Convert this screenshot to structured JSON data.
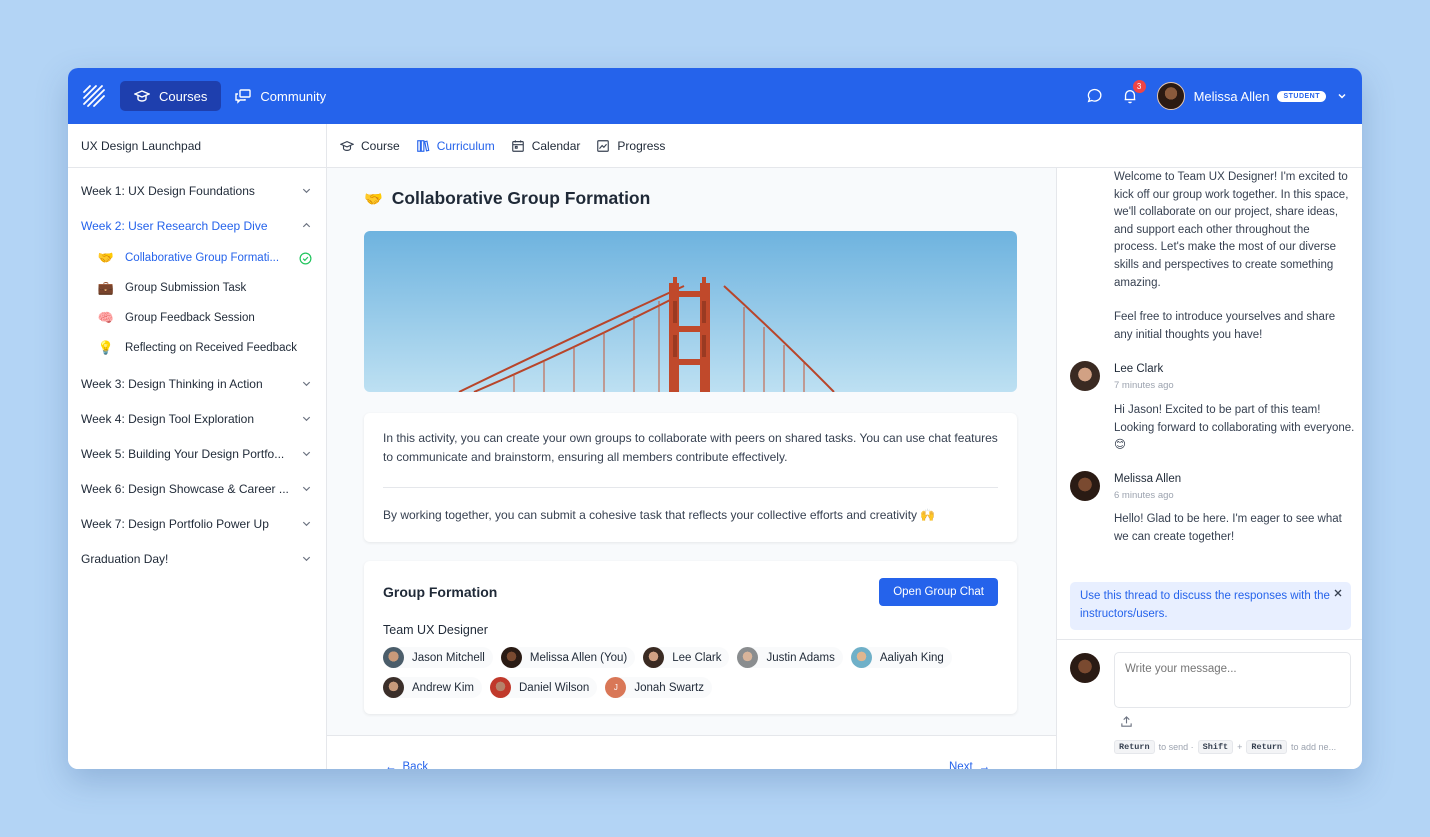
{
  "topbar": {
    "nav": [
      {
        "label": "Courses",
        "icon": "graduation-cap-icon",
        "active": true
      },
      {
        "label": "Community",
        "icon": "chat-bubbles-icon",
        "active": false
      }
    ],
    "notifications_count": "3",
    "user_name": "Melissa Allen",
    "user_role": "STUDENT"
  },
  "sidebar": {
    "course_title": "UX Design Launchpad",
    "weeks": [
      {
        "label": "Week 1: UX Design Foundations"
      },
      {
        "label": "Week 2: User Research Deep Dive"
      },
      {
        "label": "Week 3: Design Thinking in Action"
      },
      {
        "label": "Week 4: Design Tool Exploration"
      },
      {
        "label": "Week 5: Building Your Design Portfo..."
      },
      {
        "label": "Week 6: Design Showcase & Career ..."
      },
      {
        "label": "Week 7: Design Portfolio Power Up"
      },
      {
        "label": "Graduation Day!"
      }
    ],
    "week2_items": [
      {
        "emoji": "🤝",
        "label": "Collaborative Group Formati...",
        "active": true
      },
      {
        "emoji": "💼",
        "label": "Group Submission Task"
      },
      {
        "emoji": "🧠",
        "label": "Group Feedback Session"
      },
      {
        "emoji": "💡",
        "label": "Reflecting on Received Feedback"
      }
    ]
  },
  "tabs": [
    {
      "label": "Course"
    },
    {
      "label": "Curriculum",
      "active": true
    },
    {
      "label": "Calendar"
    },
    {
      "label": "Progress"
    }
  ],
  "page": {
    "emoji": "🤝",
    "title": "Collaborative Group Formation",
    "para1": "In this activity, you can create your own groups to collaborate with peers on shared tasks. You can use chat features to communicate and brainstorm, ensuring all members contribute effectively.",
    "para2": "By working together, you can submit a cohesive task that reflects your collective efforts and creativity 🙌",
    "group_formation_title": "Group Formation",
    "open_chat_label": "Open Group Chat",
    "team_name": "Team UX Designer",
    "members": [
      "Jason Mitchell",
      "Melissa Allen (You)",
      "Lee Clark",
      "Justin Adams",
      "Aaliyah King",
      "Andrew Kim",
      "Daniel Wilson",
      "Jonah Swartz"
    ],
    "initial_j": "J",
    "back_label": "Back",
    "next_label": "Next"
  },
  "chat": {
    "intro_p1": "Welcome to Team UX Designer! I'm excited to kick off our group work together. In this space, we'll collaborate on our project, share ideas, and support each other throughout the process. Let's make the most of our diverse skills and perspectives to create something amazing.",
    "intro_p2": "Feel free to introduce yourselves and share any initial thoughts you have!",
    "messages": [
      {
        "name": "Lee Clark",
        "time": "7 minutes ago",
        "text": "Hi Jason! Excited to be part of this team! Looking forward to collaborating with everyone. 😊"
      },
      {
        "name": "Melissa Allen",
        "time": "6 minutes ago",
        "text": "Hello! Glad to be here. I'm eager to see what we can create together!"
      }
    ],
    "hint": "Use this thread to discuss the responses with the instructors/users.",
    "placeholder": "Write your message...",
    "kbd_return": "Return",
    "kbd_send": "to send ·",
    "kbd_shift": "Shift",
    "kbd_plus": "+",
    "kbd_return2": "Return",
    "kbd_add": "to add ne..."
  },
  "colors": {
    "primary": "#2563eb",
    "background": "#b3d4f5",
    "hint_bg": "#e8efff"
  }
}
